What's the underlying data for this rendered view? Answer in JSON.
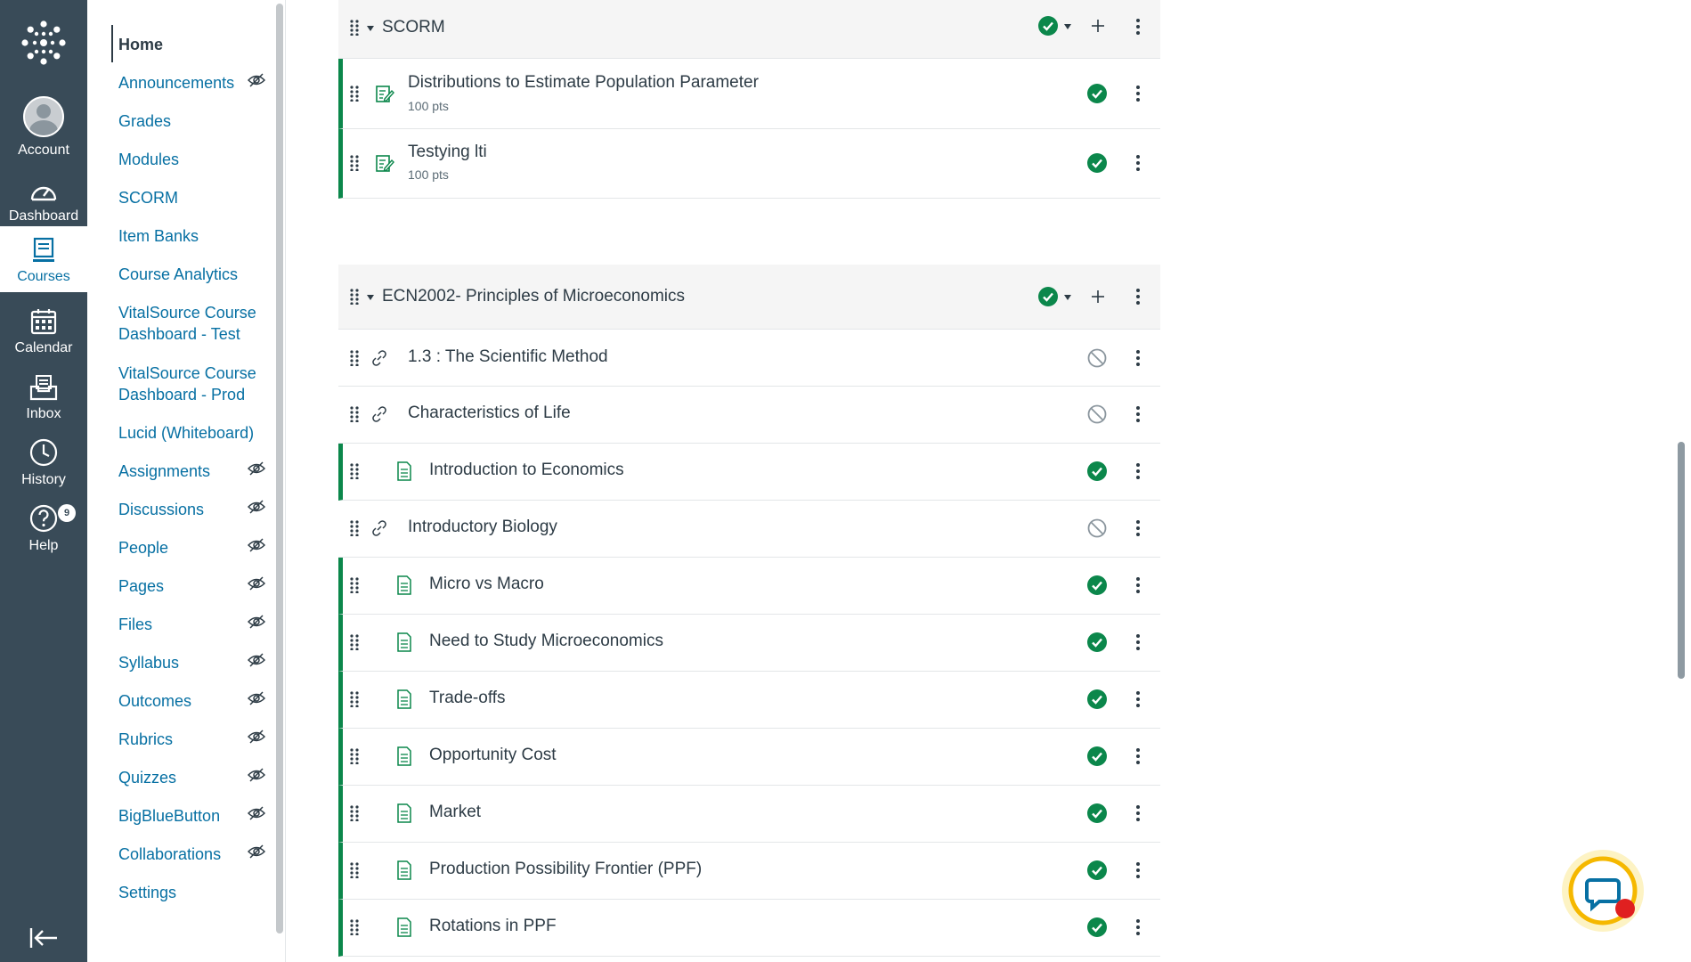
{
  "global_nav": {
    "account": "Account",
    "dashboard": "Dashboard",
    "courses": "Courses",
    "calendar": "Calendar",
    "inbox": "Inbox",
    "history": "History",
    "help": "Help",
    "help_badge": "9"
  },
  "course_nav": {
    "items": [
      {
        "label": "Home",
        "hidden": false
      },
      {
        "label": "Announcements",
        "hidden": true
      },
      {
        "label": "Grades",
        "hidden": false
      },
      {
        "label": "Modules",
        "hidden": false
      },
      {
        "label": "SCORM",
        "hidden": false
      },
      {
        "label": "Item Banks",
        "hidden": false
      },
      {
        "label": "Course Analytics",
        "hidden": false
      },
      {
        "label": "VitalSource Course Dashboard - Test",
        "hidden": false
      },
      {
        "label": "VitalSource Course Dashboard - Prod",
        "hidden": false
      },
      {
        "label": "Lucid (Whiteboard)",
        "hidden": false
      },
      {
        "label": "Assignments",
        "hidden": true
      },
      {
        "label": "Discussions",
        "hidden": true
      },
      {
        "label": "People",
        "hidden": true
      },
      {
        "label": "Pages",
        "hidden": true
      },
      {
        "label": "Files",
        "hidden": true
      },
      {
        "label": "Syllabus",
        "hidden": true
      },
      {
        "label": "Outcomes",
        "hidden": true
      },
      {
        "label": "Rubrics",
        "hidden": true
      },
      {
        "label": "Quizzes",
        "hidden": true
      },
      {
        "label": "BigBlueButton",
        "hidden": true
      },
      {
        "label": "Collaborations",
        "hidden": true
      },
      {
        "label": "Settings",
        "hidden": false
      }
    ]
  },
  "modules": [
    {
      "title": "SCORM",
      "items": [
        {
          "title": "Distributions to Estimate Population Parameter",
          "points": "100 pts",
          "type": "assignment",
          "published": true
        },
        {
          "title": "Testying lti",
          "points": "100 pts",
          "type": "assignment",
          "published": true
        }
      ]
    },
    {
      "title": "ECN2002- Principles of Microeconomics",
      "items": [
        {
          "title": "1.3 : The Scientific Method",
          "type": "link",
          "published": false
        },
        {
          "title": "Characteristics of Life",
          "type": "link",
          "published": false
        },
        {
          "title": "Introduction to Economics",
          "type": "page",
          "published": true
        },
        {
          "title": "Introductory Biology",
          "type": "link",
          "published": false
        },
        {
          "title": "Micro vs Macro",
          "type": "page",
          "published": true
        },
        {
          "title": "Need to Study Microeconomics",
          "type": "page",
          "published": true
        },
        {
          "title": "Trade-offs",
          "type": "page",
          "published": true
        },
        {
          "title": "Opportunity Cost",
          "type": "page",
          "published": true
        },
        {
          "title": "Market",
          "type": "page",
          "published": true
        },
        {
          "title": "Production Possibility Frontier (PPF)",
          "type": "page",
          "published": true
        },
        {
          "title": "Rotations in PPF",
          "type": "page",
          "published": true
        }
      ]
    }
  ],
  "colors": {
    "nav_bg": "#394b58",
    "link": "#0770a3",
    "published": "#0b874b",
    "unpublished": "#8b969e"
  }
}
